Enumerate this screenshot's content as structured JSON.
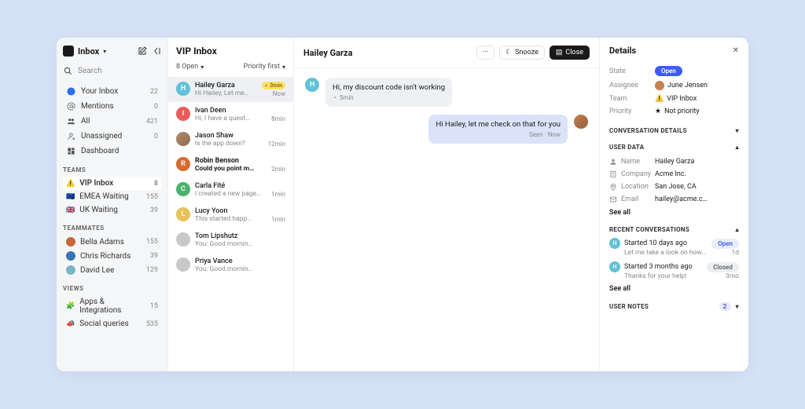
{
  "sidebar": {
    "title": "Inbox",
    "search": "Search",
    "primary": [
      {
        "icon": "user-circle-icon",
        "color": "#2f6fec",
        "label": "Your Inbox",
        "count": "22"
      },
      {
        "icon": "at-icon",
        "color": "#888",
        "label": "Mentions",
        "count": "0"
      },
      {
        "icon": "people-icon",
        "color": "#555",
        "label": "All",
        "count": "421"
      },
      {
        "icon": "unassigned-icon",
        "color": "#888",
        "label": "Unassigned",
        "count": "0"
      },
      {
        "icon": "dashboard-icon",
        "color": "#555",
        "label": "Dashboard",
        "count": ""
      }
    ],
    "teams_label": "TEAMS",
    "teams": [
      {
        "emoji": "⚠️",
        "label": "VIP Inbox",
        "count": "8",
        "selected": true
      },
      {
        "emoji": "🇪🇺",
        "label": "EMEA Waiting",
        "count": "155"
      },
      {
        "emoji": "🇬🇧",
        "label": "UK Waiting",
        "count": "39"
      }
    ],
    "teammates_label": "TEAMMATES",
    "teammates": [
      {
        "color": "#c7683a",
        "label": "Bella Adams",
        "count": "155"
      },
      {
        "color": "#3a73b1",
        "label": "Chris Richards",
        "count": "39"
      },
      {
        "color": "#7db5c5",
        "label": "David Lee",
        "count": "129"
      }
    ],
    "views_label": "VIEWS",
    "views": [
      {
        "emoji": "🧩",
        "label": "Apps & Integrations",
        "count": "15"
      },
      {
        "emoji": "📣",
        "label": "Social queries",
        "count": "535"
      }
    ]
  },
  "list": {
    "title": "VIP Inbox",
    "open": "8 Open",
    "sort": "Priority first",
    "items": [
      {
        "initial": "H",
        "color": "#61c2d6",
        "name": "Hailey Garza",
        "preview": "Hi Hailey, Let me…",
        "badge": "3min",
        "time": "Now",
        "selected": true
      },
      {
        "initial": "I",
        "color": "#e85c5c",
        "name": "Ivan Deen",
        "preview": "Hi, I have a quest…",
        "time": "8min"
      },
      {
        "initial": "",
        "color": "",
        "img": true,
        "name": "Jason Shaw",
        "preview": "Is the app down?",
        "time": "12min"
      },
      {
        "initial": "R",
        "color": "#d66a2f",
        "name": "Robin Benson",
        "preview": "Could you point m…",
        "time": "2min",
        "bold": true
      },
      {
        "initial": "C",
        "color": "#4bb36c",
        "name": "Carla Fité",
        "preview": "I created a new page…",
        "time": "1min"
      },
      {
        "initial": "L",
        "color": "#e7c15b",
        "name": "Lucy Yoon",
        "preview": "This started happ…",
        "time": "1min"
      },
      {
        "initial": "",
        "color": "#c9c9c9",
        "name": "Tom Lipshutz",
        "preview": "You: Good mornin…",
        "time": ""
      },
      {
        "initial": "",
        "color": "#c9c9c9",
        "name": "Priya Vance",
        "preview": "You: Good mornin…",
        "time": ""
      }
    ]
  },
  "thread": {
    "title": "Hailey Garza",
    "snooze": "Snooze",
    "close": "Close",
    "messages": [
      {
        "side": "left",
        "avatar": {
          "initial": "H",
          "color": "#61c2d6"
        },
        "text": "Hi, my discount code isn't working",
        "meta": "5min"
      },
      {
        "side": "right",
        "avatar": {
          "img": true,
          "color": "#c88050"
        },
        "text": "Hi Hailey, let me check on that for you",
        "meta": "Seen · Now",
        "blue": true
      }
    ]
  },
  "details": {
    "title": "Details",
    "state_lbl": "State",
    "state": "Open",
    "assignee_lbl": "Assignee",
    "assignee": "June Jensen",
    "team_lbl": "Team",
    "team": "VIP Inbox",
    "priority_lbl": "Priority",
    "priority": "Not priority",
    "conv_section": "CONVERSATION DETAILS",
    "user_section": "USER DATA",
    "user": [
      {
        "icon": "person-icon",
        "lbl": "Name",
        "val": "Hailey Garza"
      },
      {
        "icon": "building-icon",
        "lbl": "Company",
        "val": "Acme Inc."
      },
      {
        "icon": "pin-icon",
        "lbl": "Location",
        "val": "San Jose, CA"
      },
      {
        "icon": "mail-icon",
        "lbl": "Email",
        "val": "hailey@acme.c…"
      }
    ],
    "see_all": "See all",
    "recent_section": "RECENT CONVERSATIONS",
    "recent": [
      {
        "initial": "H",
        "color": "#61c2d6",
        "title": "Started 10 days ago",
        "status": "Open",
        "preview": "Let me take a look on how…",
        "age": "1d"
      },
      {
        "initial": "H",
        "color": "#61c2d6",
        "title": "Started 3 months ago",
        "status": "Closed",
        "preview": "Thanks for your help!",
        "age": "3mo"
      }
    ],
    "notes_section": "USER NOTES",
    "notes_count": "2"
  }
}
